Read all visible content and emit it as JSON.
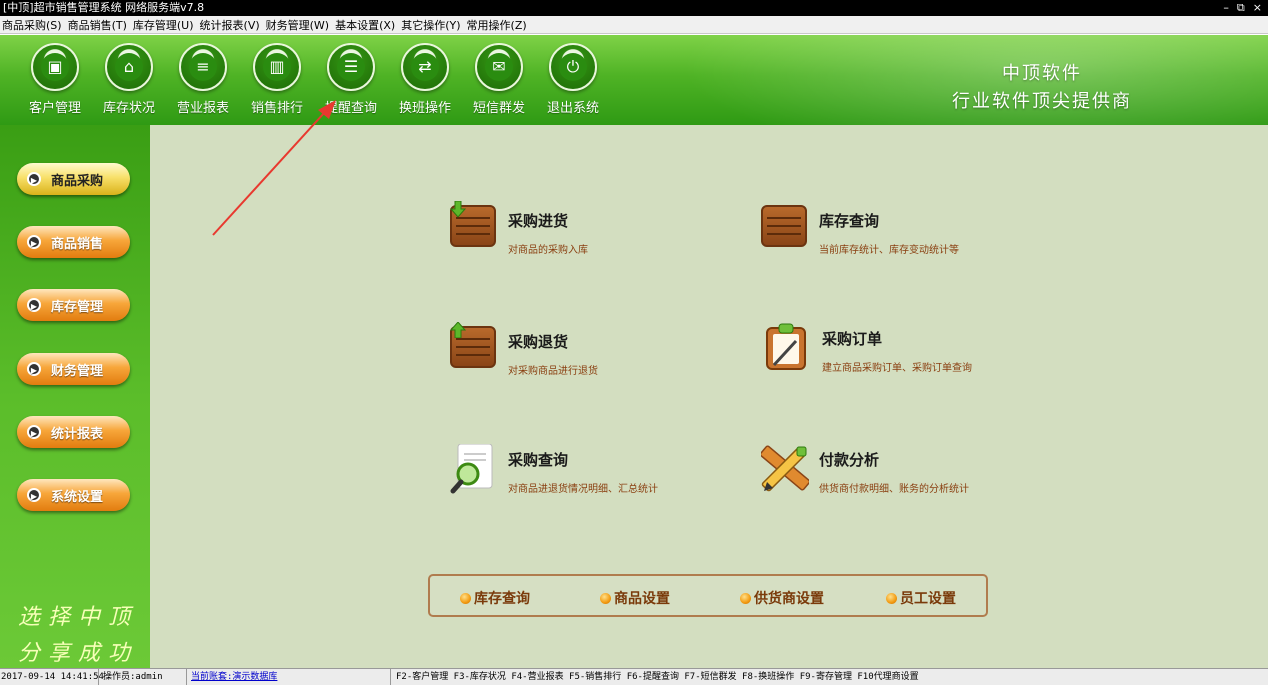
{
  "window": {
    "title": "[中顶]超市销售管理系统 网络服务端v7.8",
    "controls": [
      "–",
      "⧉",
      "×"
    ]
  },
  "menu": [
    "商品采购(S)",
    "商品销售(T)",
    "库存管理(U)",
    "统计报表(V)",
    "财务管理(W)",
    "基本设置(X)",
    "其它操作(Y)",
    "常用操作(Z)"
  ],
  "toolbar": [
    {
      "label": "客户管理",
      "icon": "customer-icon",
      "glyph": "▣"
    },
    {
      "label": "库存状况",
      "icon": "home-icon",
      "glyph": "⌂"
    },
    {
      "label": "营业报表",
      "icon": "report-icon",
      "glyph": "≡"
    },
    {
      "label": "销售排行",
      "icon": "bar-chart-icon",
      "glyph": "▥"
    },
    {
      "label": "提醒查询",
      "icon": "message-icon",
      "glyph": "☰"
    },
    {
      "label": "换班操作",
      "icon": "swap-icon",
      "glyph": "⇄"
    },
    {
      "label": "短信群发",
      "icon": "envelope-icon",
      "glyph": "✉"
    },
    {
      "label": "退出系统",
      "icon": "power-icon",
      "glyph": "⏻"
    }
  ],
  "brand": {
    "line1": "中顶软件",
    "line2": "行业软件顶尖提供商"
  },
  "sidebar": {
    "items": [
      "商品采购",
      "商品销售",
      "库存管理",
      "财务管理",
      "统计报表",
      "系统设置"
    ],
    "active_index": 0,
    "slogan1": "选择中顶",
    "slogan2": "分享成功",
    "accent_active": "#f3d84a",
    "accent_normal": "#f19a2b"
  },
  "features": [
    {
      "title": "采购进货",
      "desc": "对商品的采购入库",
      "icon": "box-in-icon"
    },
    {
      "title": "库存查询",
      "desc": "当前库存统计、库存变动统计等",
      "icon": "box-icon"
    },
    {
      "title": "采购退货",
      "desc": "对采购商品进行退货",
      "icon": "box-out-icon"
    },
    {
      "title": "采购订单",
      "desc": "建立商品采购订单、采购订单查询",
      "icon": "clipboard-icon"
    },
    {
      "title": "采购查询",
      "desc": "对商品进退货情况明细、汇总统计",
      "icon": "magnifier-icon"
    },
    {
      "title": "付款分析",
      "desc": "供货商付款明细、账务的分析统计",
      "icon": "pencil-ruler-icon"
    }
  ],
  "bottom_links": [
    "库存查询",
    "商品设置",
    "供货商设置",
    "员工设置"
  ],
  "status": {
    "datetime": "2017-09-14 14:41:54",
    "operator": "操作员:admin",
    "account": "当前账套:演示数据库",
    "shortcuts": "F2-客户管理 F3-库存状况 F4-营业报表 F5-销售排行 F6-提醒查询 F7-短信群发 F8-换班操作 F9-寄存管理 F10代理商设置"
  },
  "colors": {
    "header_green": "#4fb325",
    "content_bg": "#d3dec0",
    "annotation": "#e8392f"
  }
}
